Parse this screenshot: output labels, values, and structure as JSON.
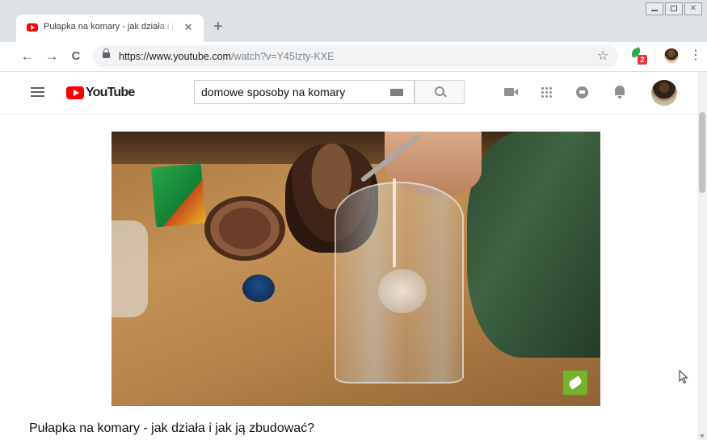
{
  "browser": {
    "tab": {
      "title": "Pułapka na komary - jak działa i j"
    },
    "new_tab_symbol": "+",
    "close_symbol": "✕",
    "url": {
      "origin": "https://www.youtube.com",
      "path": "/watch?v=Y45Izty-KXE"
    },
    "extension_badge": "2",
    "nav": {
      "back": "←",
      "forward": "→",
      "reload": "C"
    },
    "star": "☆",
    "menu": "⋮",
    "window_controls": {
      "close": "✕"
    }
  },
  "youtube": {
    "logo_text": "YouTube",
    "search": {
      "value": "domowe sposoby na komary"
    },
    "brand_color": "#ff0000"
  },
  "video": {
    "title": "Pułapka na komary - jak działa i jak ją zbudować?"
  },
  "icons": [
    "youtube-favicon-icon",
    "close-icon",
    "plus-icon",
    "back-icon",
    "forward-icon",
    "reload-icon",
    "lock-icon",
    "star-icon",
    "extension-icon",
    "kebab-menu-icon",
    "hamburger-icon",
    "keyboard-icon",
    "search-icon",
    "video-camera-icon",
    "apps-grid-icon",
    "chat-icon",
    "bell-icon"
  ]
}
